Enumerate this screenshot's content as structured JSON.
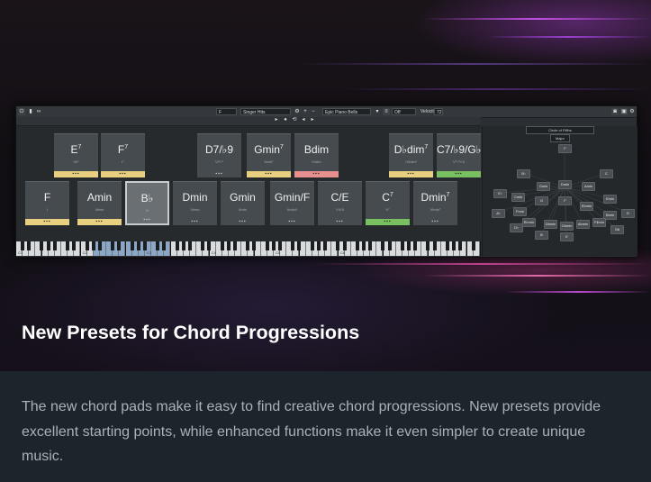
{
  "colors": {
    "yellow": "#e8d080",
    "red": "#e89090",
    "green": "#78c060",
    "key_highlight": "#8aa7c7"
  },
  "app": {
    "toolbar": {
      "key_select": "F",
      "preset": "Singer Hits",
      "instrument": "Epic Piano Bells",
      "adaptive": "Off",
      "velocity": "Velocity",
      "velocity_value": "72"
    },
    "pads": [
      {
        "name": "E",
        "sup": "7",
        "func": "VII⁷",
        "stripe": "yellow",
        "dots": "▪▪▪"
      },
      {
        "name": "F",
        "sup": "7",
        "func": "I⁷",
        "stripe": "yellow",
        "dots": "▪▪▪"
      },
      {
        "name": "D7/♭9",
        "sup": "",
        "func": "VI⁷♭⁹",
        "stripe": "",
        "dots": "▪▪▪"
      },
      {
        "name": "Gmin",
        "sup": "7",
        "func": "IImin⁷",
        "stripe": "yellow",
        "dots": "▪▪▪"
      },
      {
        "name": "Bdim",
        "sup": "",
        "func": "IVdim",
        "stripe": "red",
        "dots": "▪▪▪"
      },
      {
        "name": "D♭dim",
        "sup": "7",
        "func": "♭VIdim⁷",
        "stripe": "yellow",
        "dots": "▪▪▪"
      },
      {
        "name": "C7/♭9/G♭",
        "sup": "",
        "func": "V⁷♭⁹/♭II",
        "stripe": "green",
        "dots": "▪▪▪"
      },
      {
        "name": "F",
        "sup": "",
        "func": "I",
        "stripe": "yellow",
        "dots": "▪▪▪"
      },
      {
        "name": "Amin",
        "sup": "",
        "func": "IIImin",
        "stripe": "yellow",
        "dots": "▪▪▪"
      },
      {
        "name": "B♭",
        "sup": "",
        "func": "IV",
        "stripe": "",
        "dots": "▪▪▪"
      },
      {
        "name": "Dmin",
        "sup": "",
        "func": "VImin",
        "stripe": "",
        "dots": "▪▪▪"
      },
      {
        "name": "Gmin",
        "sup": "",
        "func": "IImin",
        "stripe": "",
        "dots": "▪▪▪"
      },
      {
        "name": "Gmin/F",
        "sup": "",
        "func": "IImin/I",
        "stripe": "",
        "dots": "▪▪▪"
      },
      {
        "name": "C/E",
        "sup": "",
        "func": "V/VII",
        "stripe": "",
        "dots": "▪▪▪"
      },
      {
        "name": "C",
        "sup": "7",
        "func": "V⁷",
        "stripe": "green",
        "dots": "▪▪▪"
      },
      {
        "name": "Dmin",
        "sup": "7",
        "func": "VImin⁷",
        "stripe": "",
        "dots": "▪▪▪"
      }
    ],
    "keyboard": {
      "labels": [
        "C1",
        "C2",
        "C3",
        "C4",
        "C5",
        "C6"
      ]
    },
    "circle": {
      "mode": "Circle of Fifths",
      "scale": "Major",
      "nodes": [
        "F",
        "B♭",
        "C",
        "Gmin",
        "Dmin",
        "Amin",
        "E♭",
        "Cmin",
        "G",
        "Fmin",
        "F",
        "Ebmin",
        "Emin",
        "A♭",
        "D",
        "B♭min",
        "Bmin",
        "Dbmin",
        "Gbmin",
        "Abmin",
        "F♯min",
        "D♭",
        "Gb",
        "B",
        "E"
      ]
    }
  },
  "page": {
    "title": "New Presets for Chord Progressions",
    "description": "The new chord pads make it easy to find creative chord progressions. New presets provide excellent starting points, while enhanced functions make it even simpler to create unique music."
  }
}
